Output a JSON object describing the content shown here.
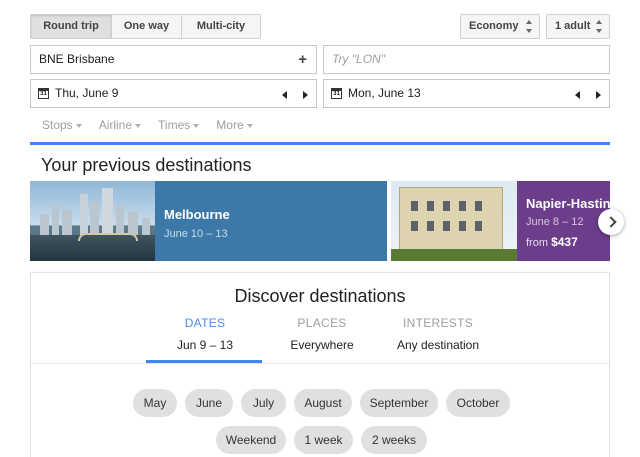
{
  "trip_types": [
    "Round trip",
    "One way",
    "Multi-city"
  ],
  "cabin": "Economy",
  "passengers": "1 adult",
  "origin": {
    "code": "BNE",
    "city": "Brisbane",
    "add_symbol": "+"
  },
  "destination": {
    "placeholder": "Try \"LON\""
  },
  "depart": {
    "icon_day": "31",
    "label": "Thu, June 9"
  },
  "return": {
    "icon_day": "31",
    "label": "Mon, June 13"
  },
  "filters": [
    "Stops",
    "Airline",
    "Times",
    "More"
  ],
  "previous": {
    "title": "Your previous destinations",
    "cards": [
      {
        "city": "Melbourne",
        "dates": "June 10 – 13",
        "price": ""
      },
      {
        "city": "Napier-Hastings",
        "dates": "June 8 – 12",
        "price_prefix": "from",
        "price": "$437"
      }
    ]
  },
  "discover": {
    "title": "Discover destinations",
    "tabs": [
      {
        "label": "DATES",
        "value": "Jun 9 – 13"
      },
      {
        "label": "PLACES",
        "value": "Everywhere"
      },
      {
        "label": "INTERESTS",
        "value": "Any destination"
      }
    ],
    "months": [
      "May",
      "June",
      "July",
      "August",
      "September",
      "October"
    ],
    "durations": [
      "Weekend",
      "1 week",
      "2 weeks"
    ]
  },
  "colors": {
    "accent": "#4285f4",
    "melbourne_card": "#3d79a8",
    "napier_card": "#6b3d8a"
  }
}
